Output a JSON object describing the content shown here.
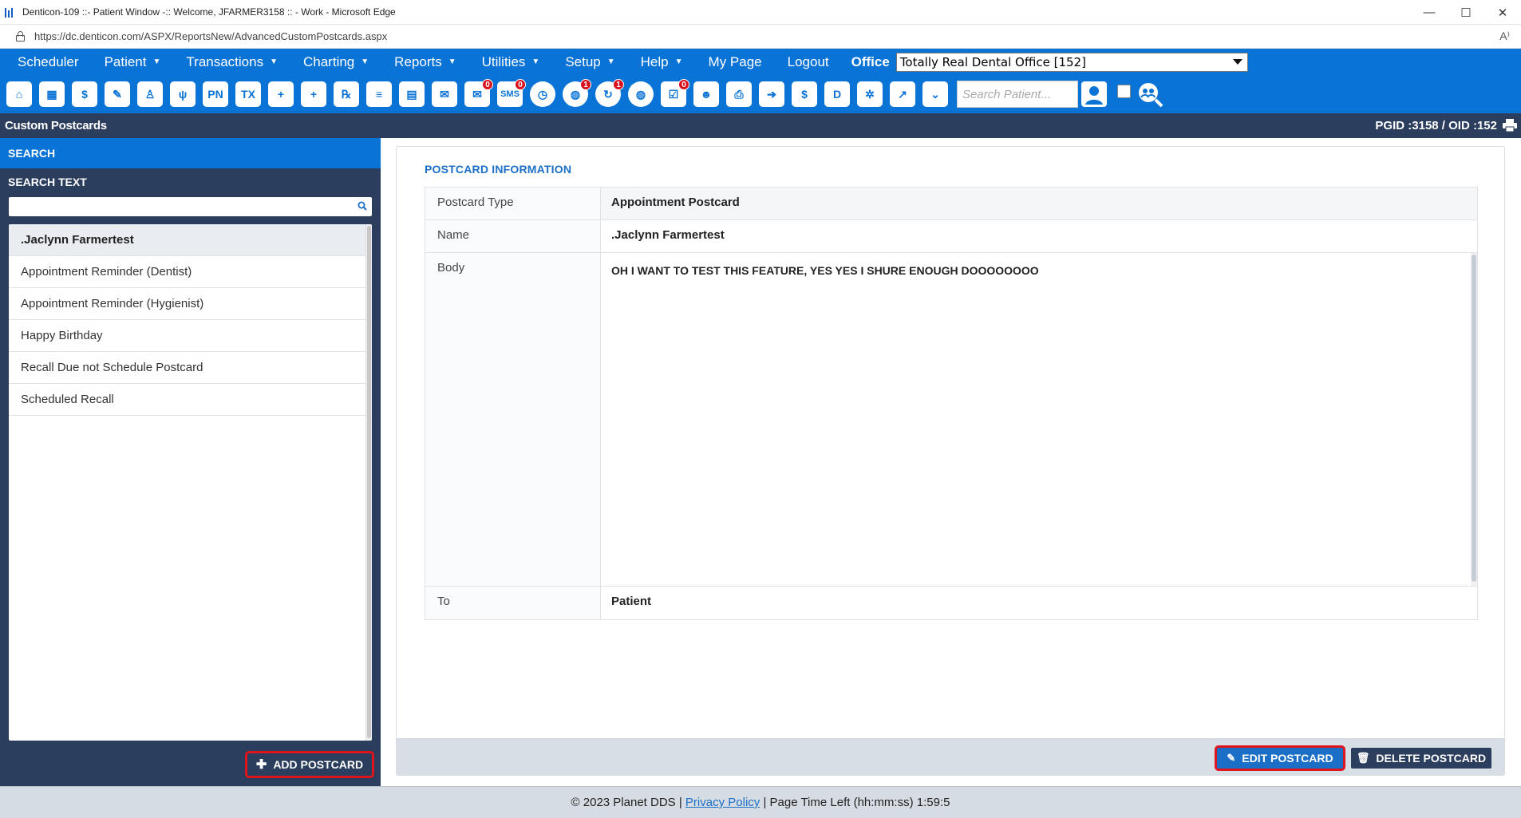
{
  "window": {
    "title": "Denticon-109 ::- Patient Window -:: Welcome, JFARMER3158 :: - Work - Microsoft Edge",
    "minimize": "—",
    "maximize": "☐",
    "close": "✕"
  },
  "browser": {
    "url": "https://dc.denticon.com/ASPX/ReportsNew/AdvancedCustomPostcards.aspx"
  },
  "menu": {
    "items": [
      {
        "label": "Scheduler",
        "has_caret": false
      },
      {
        "label": "Patient",
        "has_caret": true
      },
      {
        "label": "Transactions",
        "has_caret": true
      },
      {
        "label": "Charting",
        "has_caret": true
      },
      {
        "label": "Reports",
        "has_caret": true
      },
      {
        "label": "Utilities",
        "has_caret": true
      },
      {
        "label": "Setup",
        "has_caret": true
      },
      {
        "label": "Help",
        "has_caret": true
      },
      {
        "label": "My Page",
        "has_caret": false
      },
      {
        "label": "Logout",
        "has_caret": false
      }
    ],
    "office_label": "Office",
    "office_value": "Totally Real Dental Office [152]"
  },
  "toolbar": {
    "icons": [
      {
        "name": "home-icon",
        "glyph": "⌂"
      },
      {
        "name": "calendar-icon",
        "glyph": "▦"
      },
      {
        "name": "dollar-icon",
        "glyph": "$"
      },
      {
        "name": "notes-edit-icon",
        "glyph": "✎"
      },
      {
        "name": "tooth-icon",
        "glyph": "♙"
      },
      {
        "name": "tooth-chart-icon",
        "glyph": "ψ"
      },
      {
        "name": "progress-notes-icon",
        "glyph": "PN"
      },
      {
        "name": "treatment-icon",
        "glyph": "TX"
      },
      {
        "name": "add-patient-icon",
        "glyph": "+"
      },
      {
        "name": "add-family-icon",
        "glyph": "+"
      },
      {
        "name": "prescription-icon",
        "glyph": "℞"
      },
      {
        "name": "document-icon",
        "glyph": "≡"
      },
      {
        "name": "print-doc-icon",
        "glyph": "▤"
      },
      {
        "name": "mail-icon",
        "glyph": "✉"
      },
      {
        "name": "message-icon",
        "glyph": "✉",
        "badge": "0"
      },
      {
        "name": "sms-icon",
        "glyph": "SMS",
        "badge": "0"
      },
      {
        "name": "clock-icon",
        "glyph": "◷"
      },
      {
        "name": "globe-alert-icon",
        "glyph": "◍",
        "badge": "1"
      },
      {
        "name": "refresh-user-icon",
        "glyph": "↻",
        "badge": "1"
      },
      {
        "name": "web-icon",
        "glyph": "◍"
      },
      {
        "name": "checklist-icon",
        "glyph": "☑",
        "badge": "0"
      },
      {
        "name": "family-icon",
        "glyph": "☻"
      },
      {
        "name": "printer-icon",
        "glyph": "⎙"
      },
      {
        "name": "arrow-shield-icon",
        "glyph": "➔"
      },
      {
        "name": "money-shield-icon",
        "glyph": "$"
      },
      {
        "name": "daysheet-icon",
        "glyph": "D"
      },
      {
        "name": "network-icon",
        "glyph": "✲"
      },
      {
        "name": "line-chart-icon",
        "glyph": "↗"
      },
      {
        "name": "chevron-down-shield-icon",
        "glyph": "⌄"
      }
    ],
    "search_placeholder": "Search Patient...",
    "patient-search-icon": "person-search-icon",
    "group-search-icon": "group-search-icon"
  },
  "page_header": {
    "title": "Custom Postcards",
    "ids": "PGID :3158  /  OID :152"
  },
  "left_panel": {
    "search_heading": "SEARCH",
    "search_text_label": "SEARCH TEXT",
    "search_value": "",
    "postcards": [
      {
        "label": ".Jaclynn Farmertest",
        "selected": true
      },
      {
        "label": "Appointment Reminder (Dentist)",
        "selected": false
      },
      {
        "label": "Appointment Reminder (Hygienist)",
        "selected": false
      },
      {
        "label": "Happy Birthday",
        "selected": false
      },
      {
        "label": "Recall Due not Schedule Postcard",
        "selected": false
      },
      {
        "label": "Scheduled Recall",
        "selected": false
      }
    ],
    "add_button": "ADD POSTCARD"
  },
  "postcard_info": {
    "section_title": "POSTCARD INFORMATION",
    "type_label": "Postcard Type",
    "type_value": "Appointment Postcard",
    "name_label": "Name",
    "name_value": ".Jaclynn Farmertest",
    "body_label": "Body",
    "body_value": "OH I WANT TO TEST THIS FEATURE, YES YES I SHURE ENOUGH DOOOOOOOO",
    "to_label": "To",
    "to_value": "Patient",
    "edit_button": "EDIT POSTCARD",
    "delete_button": "DELETE POSTCARD"
  },
  "footer": {
    "copyright": "© 2023 Planet DDS |",
    "privacy_link": "Privacy Policy",
    "time_left": "| Page Time Left (hh:mm:ss) 1:59:5"
  },
  "colors": {
    "brand_blue": "#0a73d6",
    "navy": "#2c3e5d",
    "highlight_red": "#e0141c",
    "badge_red": "#d9121f"
  }
}
